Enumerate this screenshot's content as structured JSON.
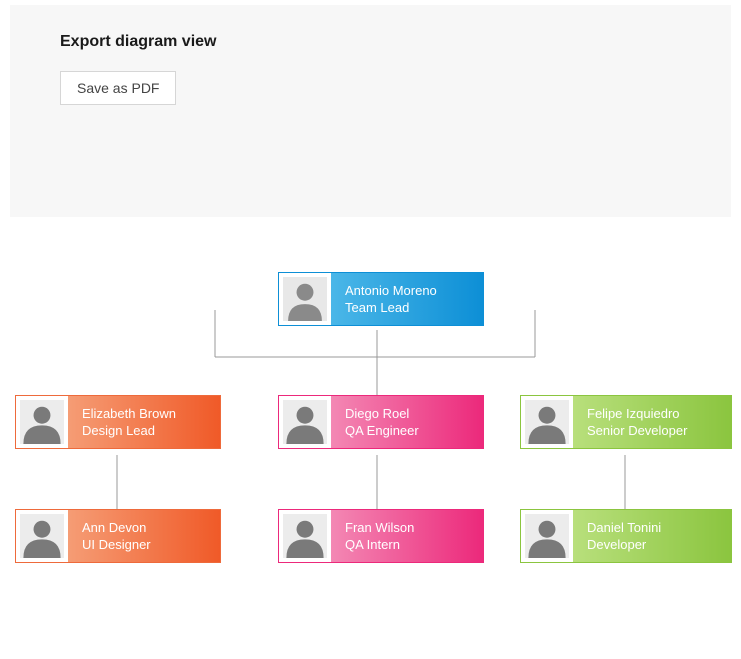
{
  "header": {
    "title": "Export diagram view",
    "save_button": "Save as PDF"
  },
  "nodes": {
    "root": {
      "name": "Antonio Moreno",
      "title": "Team Lead",
      "color": "blue"
    },
    "design_lead": {
      "name": "Elizabeth Brown",
      "title": "Design Lead",
      "color": "orange"
    },
    "qa_engineer": {
      "name": "Diego Roel",
      "title": "QA Engineer",
      "color": "pink"
    },
    "senior_dev": {
      "name": "Felipe Izquiedro",
      "title": "Senior Developer",
      "color": "green"
    },
    "ui_designer": {
      "name": "Ann Devon",
      "title": "UI Designer",
      "color": "orange"
    },
    "qa_intern": {
      "name": "Fran Wilson",
      "title": "QA Intern",
      "color": "pink"
    },
    "developer": {
      "name": "Daniel Tonini",
      "title": "Developer",
      "color": "green"
    }
  },
  "hierarchy": {
    "root": "root",
    "children": [
      {
        "id": "design_lead",
        "children": [
          "ui_designer"
        ]
      },
      {
        "id": "qa_engineer",
        "children": [
          "qa_intern"
        ]
      },
      {
        "id": "senior_dev",
        "children": [
          "developer"
        ]
      }
    ]
  },
  "colors": {
    "blue": "#0d8fd6",
    "orange": "#f05a28",
    "pink": "#ec297b",
    "green": "#8bc53f",
    "panel_bg": "#f7f7f7",
    "connector": "#999999"
  }
}
